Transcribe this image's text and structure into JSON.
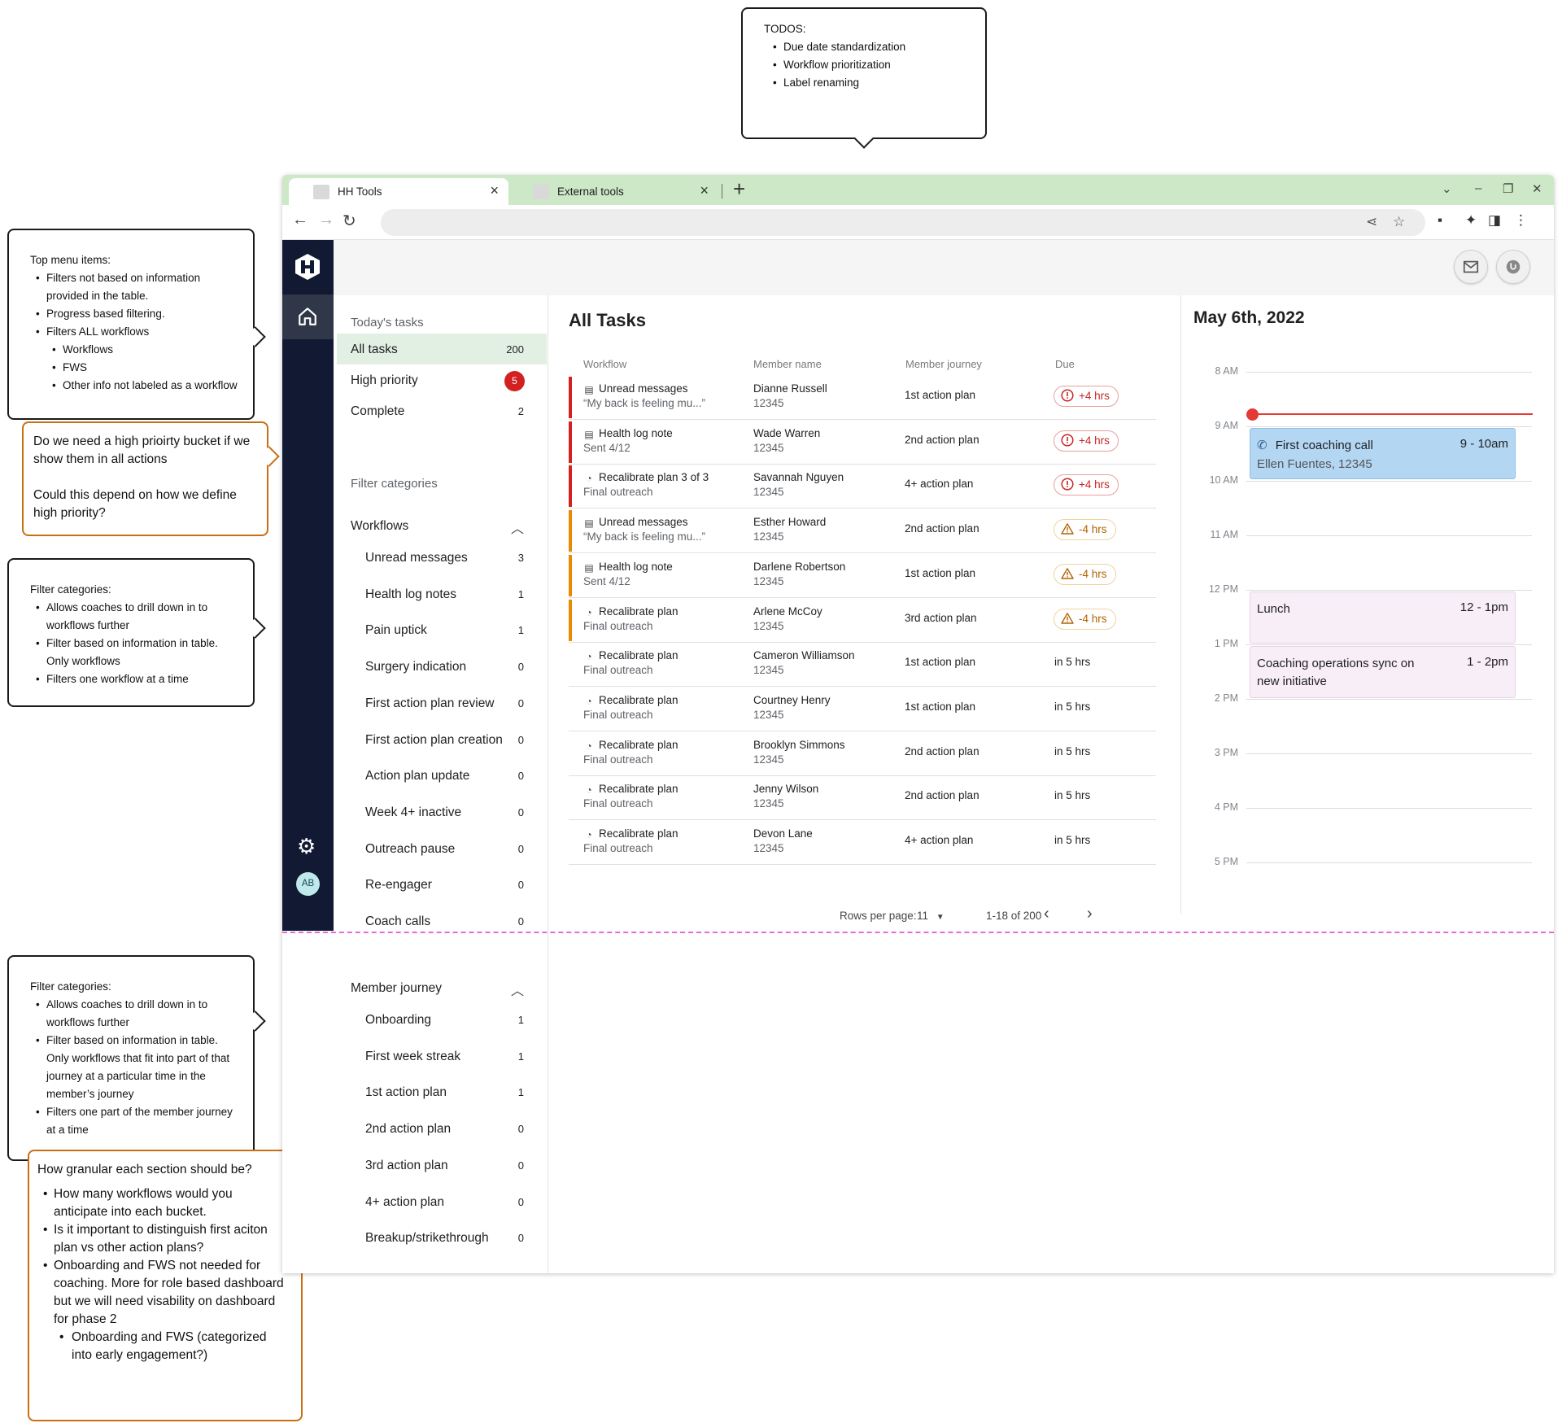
{
  "callouts": {
    "todos": {
      "title": "TODOS:",
      "items": [
        "Due date standardization",
        "Workflow prioritization",
        "Label renaming"
      ]
    },
    "top_menu": {
      "title": "Top menu items:",
      "items": [
        {
          "text": "Filters not based on information provided in the table.",
          "sub": false
        },
        {
          "text": "Progress based filtering.",
          "sub": false
        },
        {
          "text": "Filters ALL workflows",
          "sub": false
        },
        {
          "text": "Workflows",
          "sub": true
        },
        {
          "text": "FWS",
          "sub": true
        },
        {
          "text": "Other info not labeled as a workflow",
          "sub": true
        }
      ]
    },
    "high_priority_q": {
      "p1": "Do we need a high prioirty bucket if we show them in all actions",
      "p2": "Could this depend on how we define high priority?"
    },
    "filter_cat_1": {
      "title": "Filter categories:",
      "items": [
        "Allows coaches to drill down in to workflows further",
        "Filter based on information in table. Only workflows",
        "Filters one workflow at a time"
      ]
    },
    "filter_cat_2": {
      "title": "Filter categories:",
      "items": [
        "Allows coaches to drill down in to workflows further",
        "Filter based on information in table. Only workflows that fit into part of that journey at a particular time in the member’s journey",
        "Filters one part of the member journey at a time"
      ]
    },
    "granular_q": {
      "title": "How granular each section should be?",
      "items": [
        {
          "text": "How many workflows would you anticipate into each bucket.",
          "sub": false
        },
        {
          "text": "Is it important to distinguish first aciton plan vs other action plans?",
          "sub": false
        },
        {
          "text": "Onboarding and FWS not needed for coaching. More for role based dashboard but we will need visability on dashboard for phase 2",
          "sub": false
        },
        {
          "text": "Onboarding and FWS (categorized into early engagement?)",
          "sub": true
        }
      ]
    }
  },
  "browser": {
    "tabs": [
      {
        "title": "HH Tools",
        "active": true
      },
      {
        "title": "External tools",
        "active": false
      }
    ],
    "close_glyph": "×",
    "new_tab_glyph": "+"
  },
  "sidebar": {
    "avatar_initials": "AB",
    "today_heading": "Today's tasks",
    "today_items": [
      {
        "label": "All tasks",
        "count": "200"
      },
      {
        "label": "High priority",
        "count": "5"
      },
      {
        "label": "Complete",
        "count": "2"
      }
    ],
    "filter_heading": "Filter categories",
    "workflows_heading": "Workflows",
    "workflows": [
      {
        "label": "Unread messages",
        "count": "3"
      },
      {
        "label": "Health log notes",
        "count": "1"
      },
      {
        "label": "Pain uptick",
        "count": "1"
      },
      {
        "label": "Surgery indication",
        "count": "0"
      },
      {
        "label": "First action plan review",
        "count": "0"
      },
      {
        "label": "First action plan creation",
        "count": "0"
      },
      {
        "label": "Action plan update",
        "count": "0"
      },
      {
        "label": "Week 4+ inactive",
        "count": "0"
      },
      {
        "label": "Outreach pause",
        "count": "0"
      },
      {
        "label": "Re-engager",
        "count": "0"
      },
      {
        "label": "Coach calls",
        "count": "0"
      }
    ],
    "journey_heading": "Member journey",
    "journey": [
      {
        "label": "Onboarding",
        "count": "1"
      },
      {
        "label": "First week streak",
        "count": "1"
      },
      {
        "label": "1st action plan",
        "count": "1"
      },
      {
        "label": "2nd action plan",
        "count": "0"
      },
      {
        "label": "3rd action plan",
        "count": "0"
      },
      {
        "label": "4+ action plan",
        "count": "0"
      },
      {
        "label": "Breakup/strikethrough",
        "count": "0"
      }
    ]
  },
  "main": {
    "title": "All Tasks",
    "columns": [
      "Workflow",
      "Member name",
      "Member journey",
      "Due"
    ],
    "rows": [
      {
        "workflow": "Unread messages",
        "detail": "“My back is feeling mu...”",
        "icon": "message-icon",
        "member": "Dianne Russell",
        "id": "12345",
        "journey": "1st action plan",
        "due": "+4 hrs",
        "status": "overdue"
      },
      {
        "workflow": "Health log note",
        "detail": "Sent 4/12",
        "icon": "message-icon",
        "member": "Wade Warren",
        "id": "12345",
        "journey": "2nd action plan",
        "due": "+4 hrs",
        "status": "overdue"
      },
      {
        "workflow": "Recalibrate plan 3 of 3",
        "detail": "Final outreach",
        "icon": "recalibrate-icon",
        "member": "Savannah Nguyen",
        "id": "12345",
        "journey": "4+ action plan",
        "due": "+4 hrs",
        "status": "overdue"
      },
      {
        "workflow": "Unread messages",
        "detail": "“My back is feeling mu...”",
        "icon": "message-icon",
        "member": "Esther Howard",
        "id": "12345",
        "journey": "2nd action plan",
        "due": "-4 hrs",
        "status": "warning"
      },
      {
        "workflow": "Health log note",
        "detail": "Sent 4/12",
        "icon": "message-icon",
        "member": "Darlene Robertson",
        "id": "12345",
        "journey": "1st action plan",
        "due": "-4 hrs",
        "status": "warning"
      },
      {
        "workflow": "Recalibrate plan",
        "detail": "Final outreach",
        "icon": "recalibrate-icon",
        "member": "Arlene McCoy",
        "id": "12345",
        "journey": "3rd action plan",
        "due": "-4 hrs",
        "status": "warning"
      },
      {
        "workflow": "Recalibrate plan",
        "detail": "Final outreach",
        "icon": "recalibrate-icon",
        "member": "Cameron Williamson",
        "id": "12345",
        "journey": "1st action plan",
        "due": "in 5 hrs",
        "status": "normal"
      },
      {
        "workflow": "Recalibrate plan",
        "detail": "Final outreach",
        "icon": "recalibrate-icon",
        "member": "Courtney Henry",
        "id": "12345",
        "journey": "1st action plan",
        "due": "in 5 hrs",
        "status": "normal"
      },
      {
        "workflow": "Recalibrate plan",
        "detail": "Final outreach",
        "icon": "recalibrate-icon",
        "member": "Brooklyn Simmons",
        "id": "12345",
        "journey": "2nd action plan",
        "due": "in 5 hrs",
        "status": "normal"
      },
      {
        "workflow": "Recalibrate plan",
        "detail": "Final outreach",
        "icon": "recalibrate-icon",
        "member": "Jenny Wilson",
        "id": "12345",
        "journey": "2nd action plan",
        "due": "in 5 hrs",
        "status": "normal"
      },
      {
        "workflow": "Recalibrate plan",
        "detail": "Final outreach",
        "icon": "recalibrate-icon",
        "member": "Devon Lane",
        "id": "12345",
        "journey": "4+ action plan",
        "due": "in 5 hrs",
        "status": "normal"
      }
    ],
    "pagination": {
      "rows_label": "Rows per page:",
      "rows_value": "11",
      "range": "1-18 of 200"
    }
  },
  "calendar": {
    "title": "May 6th, 2022",
    "hours": [
      "8 AM",
      "9 AM",
      "10 AM",
      "11 AM",
      "12 PM",
      "1 PM",
      "2 PM",
      "3 PM",
      "4 PM",
      "5 PM"
    ],
    "events": [
      {
        "name": "First coaching call",
        "sub": "Ellen Fuentes, 12345",
        "time": "9 - 10am",
        "color": "blue"
      },
      {
        "name": "Lunch",
        "time": "12 - 1pm",
        "color": "pink"
      },
      {
        "name": "Coaching operations sync on new initiative",
        "time": "1 - 2pm",
        "color": "pink"
      }
    ]
  },
  "colors": {
    "rail": "#121a33",
    "selected": "#e2f0e4",
    "overdue": "#d32020",
    "warning": "#e98a00",
    "tabbar": "#cde8c6"
  }
}
